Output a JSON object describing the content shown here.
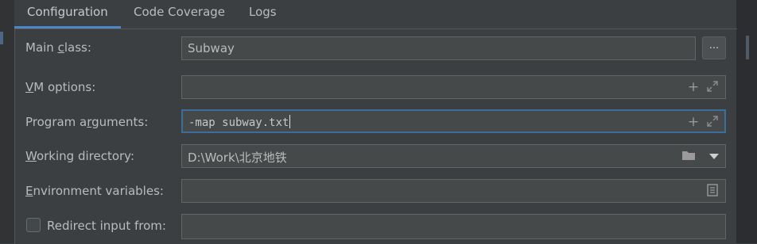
{
  "tabs": [
    {
      "label": "Configuration",
      "active": true
    },
    {
      "label": "Code Coverage",
      "active": false
    },
    {
      "label": "Logs",
      "active": false
    }
  ],
  "form": {
    "main_class": {
      "label_pre": "Main ",
      "label_mn": "c",
      "label_post": "lass:",
      "value": "Subway",
      "browse_label": "..."
    },
    "vm_options": {
      "label_pre": "",
      "label_mn": "V",
      "label_post": "M options:",
      "value": ""
    },
    "program_arguments": {
      "label_pre": "Program a",
      "label_mn": "r",
      "label_post": "guments:",
      "value": "-map subway.txt"
    },
    "working_directory": {
      "label_pre": "",
      "label_mn": "W",
      "label_post": "orking directory:",
      "value": "D:\\Work\\北京地铁"
    },
    "environment_variables": {
      "label_pre": "",
      "label_mn": "E",
      "label_post": "nvironment variables:",
      "value": ""
    },
    "redirect_input": {
      "label": "Redirect input from:",
      "checked": false,
      "value": ""
    }
  },
  "icons": {
    "add": "add-icon",
    "expand": "expand-icon",
    "folder": "folder-icon",
    "dropdown": "chevron-down-icon",
    "document": "document-icon"
  },
  "colors": {
    "background": "#3c3f41",
    "field_background": "#45494a",
    "focus_border": "#3d6d9b",
    "tab_underline": "#4a88c7",
    "text": "#bbbbbb"
  }
}
